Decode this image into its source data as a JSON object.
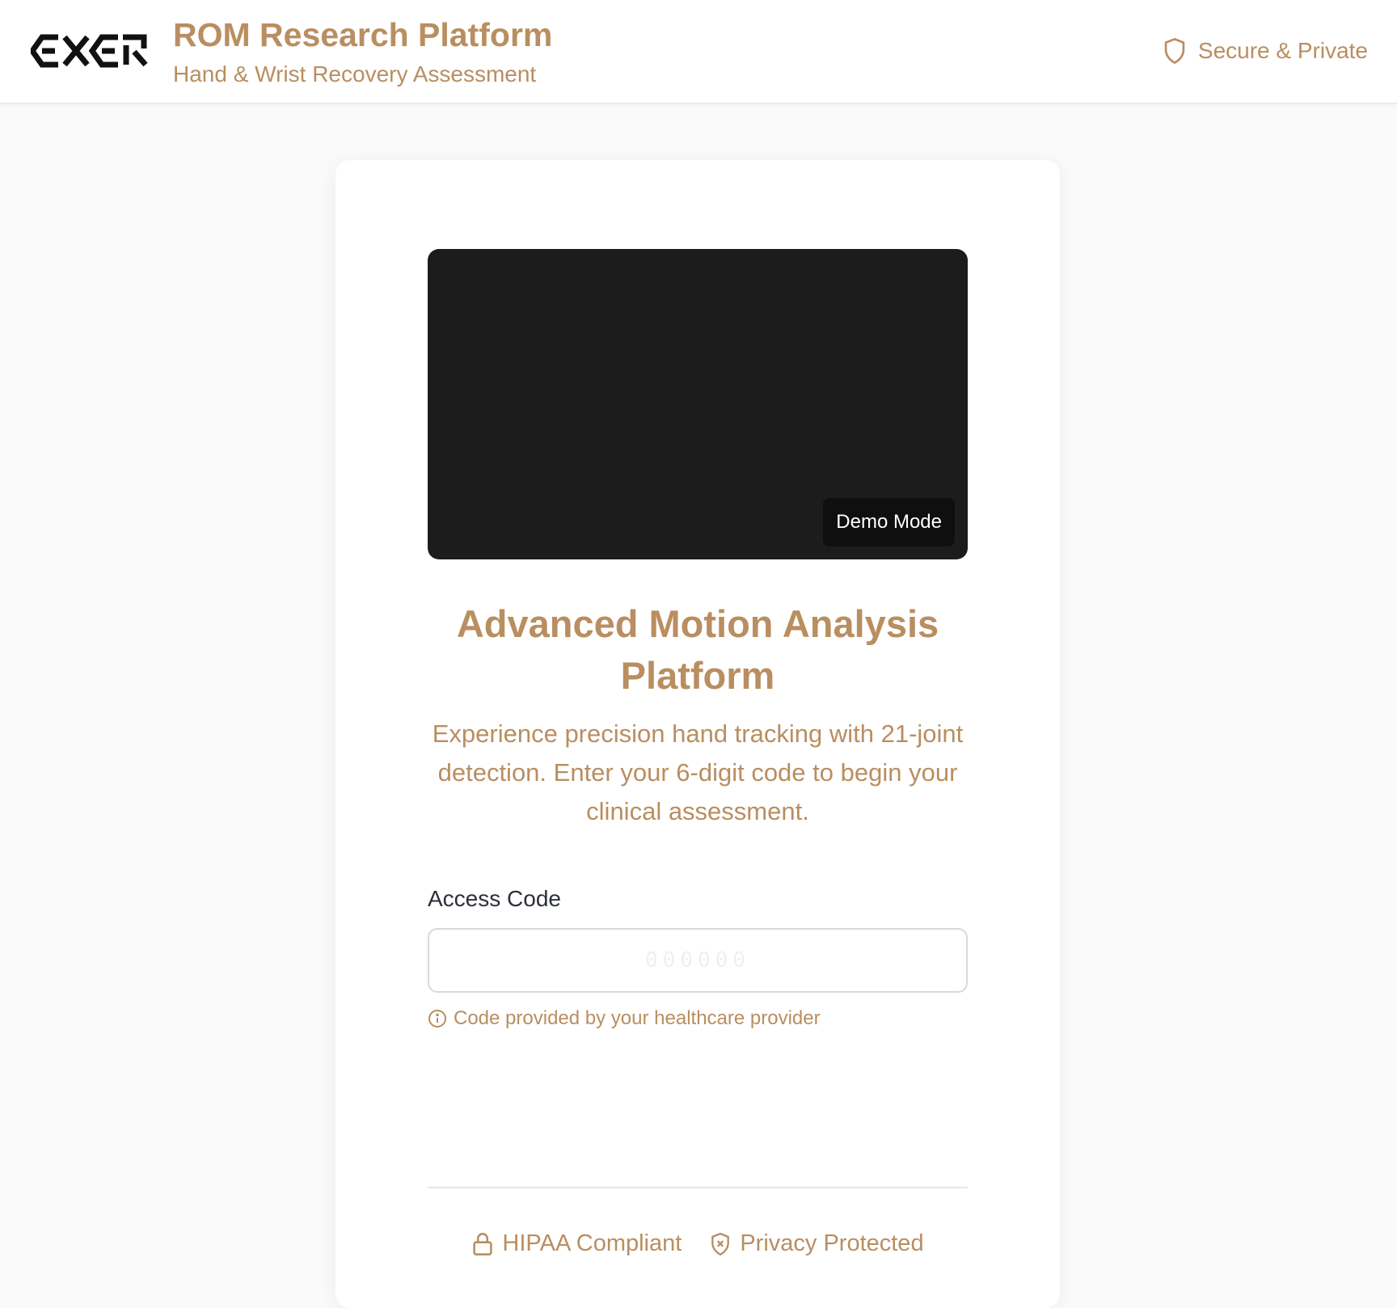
{
  "header": {
    "logo_text": "EXER",
    "title": "ROM Research Platform",
    "subtitle": "Hand & Wrist Recovery Assessment",
    "security_label": "Secure & Private",
    "security_icon": "shield-icon"
  },
  "preview": {
    "badge_label": "Demo Mode"
  },
  "intro": {
    "headline": "Advanced Motion Analysis Platform",
    "description": "Experience precision hand tracking with 21-joint detection. Enter your 6-digit code to begin your clinical assessment."
  },
  "access_form": {
    "label": "Access Code",
    "value": "",
    "placeholder": "000000",
    "hint": "Code provided by your healthcare provider",
    "hint_icon": "info-icon"
  },
  "footer": {
    "badges": [
      {
        "label": "HIPAA Compliant",
        "icon": "lock-icon"
      },
      {
        "label": "Privacy Protected",
        "icon": "shield-x-icon"
      }
    ]
  },
  "colors": {
    "accent": "#b98e60",
    "video_background": "#1c1c1c",
    "page_background": "#fafafa",
    "label_text": "#2b2f3a"
  }
}
